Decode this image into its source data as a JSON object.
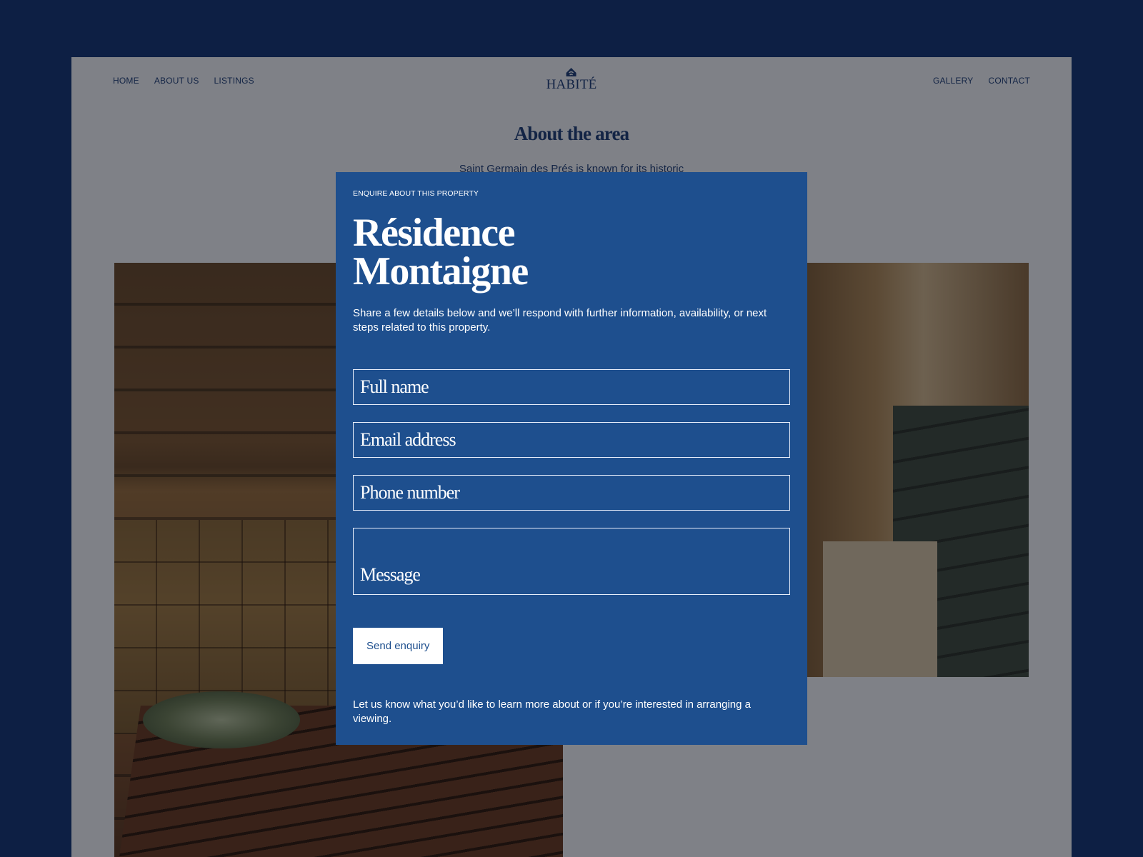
{
  "nav": {
    "left": [
      "HOME",
      "ABOUT US",
      "LISTINGS"
    ],
    "right": [
      "GALLERY",
      "CONTACT"
    ]
  },
  "logo": {
    "text": "HABITÉ",
    "icon": "house-logo-icon"
  },
  "about": {
    "title": "About the area",
    "text": "Saint Germain des Prés is known for its historic"
  },
  "modal": {
    "eyebrow": "ENQUIRE ABOUT THIS PROPERTY",
    "title": "Résidence Montaigne",
    "description": "Share a few details below and we’ll respond with further information, availability, or next steps related to this property.",
    "fields": {
      "full_name": "Full name",
      "email": "Email address",
      "phone": "Phone number",
      "message": "Message"
    },
    "submit_label": "Send enquiry",
    "footer": "Let us know what you’d like to learn more about or if you’re interested in arranging a viewing."
  },
  "colors": {
    "outer_background": "#0d1f44",
    "brand_navy": "#1e3f7a",
    "modal_blue": "#1e4f8e",
    "overlay": "rgba(8,10,16,0.5)"
  }
}
